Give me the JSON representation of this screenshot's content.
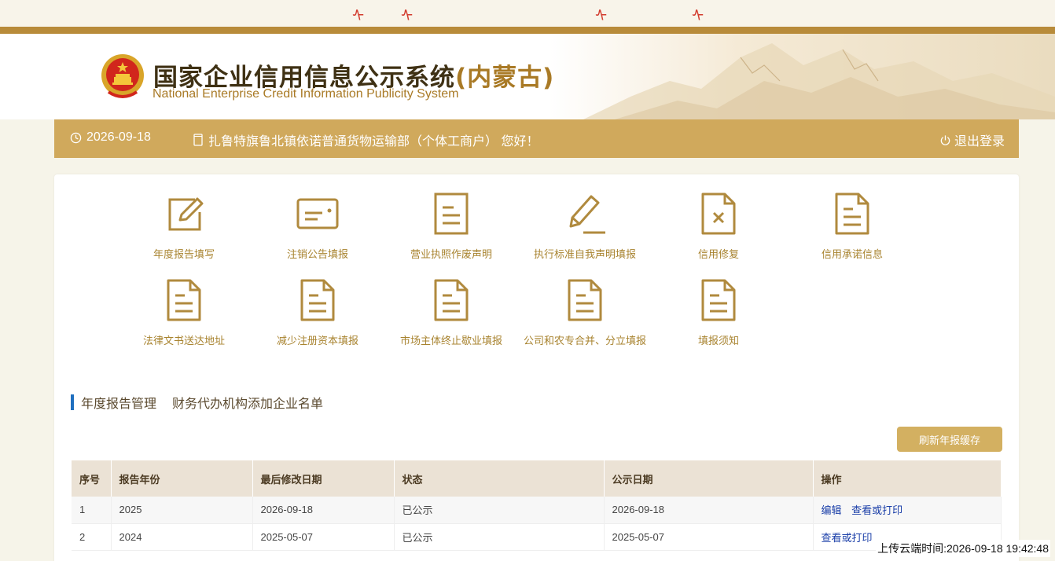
{
  "header": {
    "title_main": "国家企业信用信息公示系统",
    "title_region": "(内蒙古)",
    "subtitle": "National Enterprise Credit Information Publicity System"
  },
  "user_bar": {
    "date": "2026-09-18",
    "greeting": "扎鲁特旗鲁北镇依诺普通货物运输部（个体工商户） 您好！",
    "logout": "退出登录"
  },
  "menu": [
    {
      "label": "年度报告填写",
      "icon": "edit-icon"
    },
    {
      "label": "注销公告填报",
      "icon": "id-card-icon"
    },
    {
      "label": "营业执照作废声明",
      "icon": "document-icon"
    },
    {
      "label": "执行标准自我声明填报",
      "icon": "pencil-icon"
    },
    {
      "label": "信用修复",
      "icon": "document-x-icon"
    },
    {
      "label": "信用承诺信息",
      "icon": "document-lines-icon"
    },
    {
      "label": "法律文书送达地址",
      "icon": "document-lines-icon"
    },
    {
      "label": "减少注册资本填报",
      "icon": "document-lines-icon"
    },
    {
      "label": "市场主体终止歇业填报",
      "icon": "document-lines-icon"
    },
    {
      "label": "公司和农专合并、分立填报",
      "icon": "document-lines-icon"
    },
    {
      "label": "填报须知",
      "icon": "document-lines-icon"
    }
  ],
  "tabs": [
    "年度报告管理",
    "财务代办机构添加企业名单"
  ],
  "refresh_button": "刷新年报缓存",
  "table": {
    "headers": [
      "序号",
      "报告年份",
      "最后修改日期",
      "状态",
      "公示日期",
      "操作"
    ],
    "rows": [
      {
        "no": "1",
        "year": "2025",
        "modified": "2026-09-18",
        "status": "已公示",
        "published": "2026-09-18",
        "actions": [
          "编辑",
          "查看或打印"
        ]
      },
      {
        "no": "2",
        "year": "2024",
        "modified": "2025-05-07",
        "status": "已公示",
        "published": "2025-05-07",
        "actions": [
          "查看或打印"
        ]
      }
    ]
  },
  "upload_time": "上传云端时间:2026-09-18 19:42:48",
  "colors": {
    "gold": "#b88b3a",
    "bar": "#d0a95c",
    "tile_icon": "#b08a3e",
    "accent_blue": "#1f6fbf",
    "link": "#1a3ea8"
  }
}
